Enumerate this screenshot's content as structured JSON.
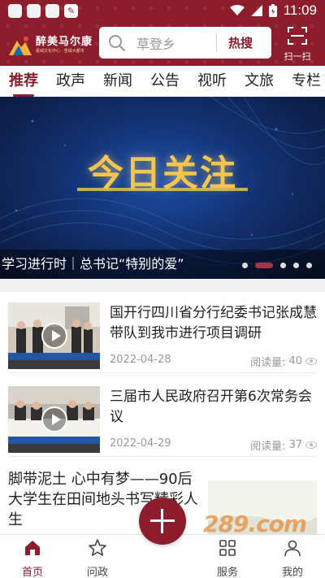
{
  "status_bar": {
    "time": "11:09"
  },
  "header": {
    "logo_title": "醉美马尔康",
    "logo_subtitle": "嘉绒文化中心 · 雪域大都市",
    "search_placeholder": "草登乡",
    "hot_search_label": "热搜",
    "scan_label": "扫一扫"
  },
  "tabs": [
    {
      "label": "推荐",
      "active": true
    },
    {
      "label": "政声"
    },
    {
      "label": "新闻"
    },
    {
      "label": "公告"
    },
    {
      "label": "视听"
    },
    {
      "label": "文旅"
    },
    {
      "label": "专栏"
    }
  ],
  "banner": {
    "headline": "今日关注",
    "caption": "学习进行时｜总书记“特别的爱”",
    "slide_count": 5,
    "active_slide": 2
  },
  "news": [
    {
      "title": "国开行四川省分行纪委书记张成慧带队到我市进行项目调研",
      "date": "2022-04-28",
      "reads_label": "阅读量:",
      "reads": "40",
      "has_video": true
    },
    {
      "title": "三届市人民政府召开第6次常务会议",
      "date": "2022-04-29",
      "reads_label": "阅读量:",
      "reads": "37",
      "has_video": true
    },
    {
      "title": "脚带泥土 心中有梦——90后大学生在田间地头书写精彩人生"
    }
  ],
  "bottom_nav": {
    "home": "首页",
    "ask": "问政",
    "service": "服务",
    "me": "我的"
  },
  "watermark": "289.com",
  "colors": {
    "brand": "#8d1c2c",
    "banner_gold": "#f5c64e"
  }
}
